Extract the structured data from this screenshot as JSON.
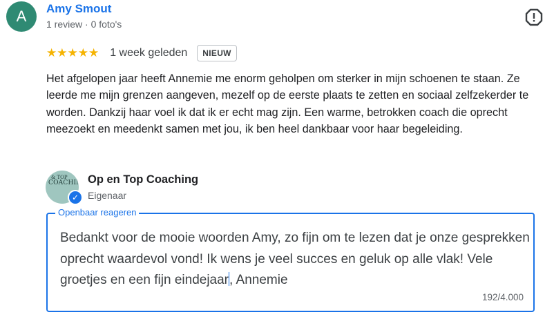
{
  "review": {
    "avatar_initial": "A",
    "reviewer_name": "Amy Smout",
    "reviewer_meta": "1 review · 0 foto's",
    "rating": 5,
    "stars": "★★★★★",
    "date": "1 week geleden",
    "badge": "NIEUW",
    "text": "Het afgelopen jaar heeft Annemie me enorm geholpen om sterker in mijn schoenen te staan. Ze leerde me mijn grenzen aangeven, mezelf op de eerste plaats te zetten en sociaal zelfzekerder te worden. Dankzij haar voel ik dat ik er echt mag zijn. Een warme, betrokken coach die oprecht meezoekt en meedenkt samen met jou, ik ben heel dankbaar voor haar begeleiding."
  },
  "owner": {
    "logo_text_top": "& TOP",
    "logo_text_main": "COACHING",
    "name": "Op en Top Coaching",
    "role": "Eigenaar"
  },
  "reply": {
    "legend": "Openbaar reageren",
    "text_before_caret": "Bedankt voor de mooie woorden Amy, zo fijn om te lezen dat je onze gesprekken oprecht waardevol vond! Ik wens je veel succes en geluk op alle vlak! Vele groetjes en een fijn eindejaar",
    "text_after_caret": ", Annemie",
    "char_count": "192/4.000"
  },
  "colors": {
    "accent": "#1a73e8",
    "avatar": "#2f8a73",
    "star": "#f5b301"
  },
  "icons": {
    "flag": "report-flag-icon",
    "verified": "verified-check-icon"
  }
}
